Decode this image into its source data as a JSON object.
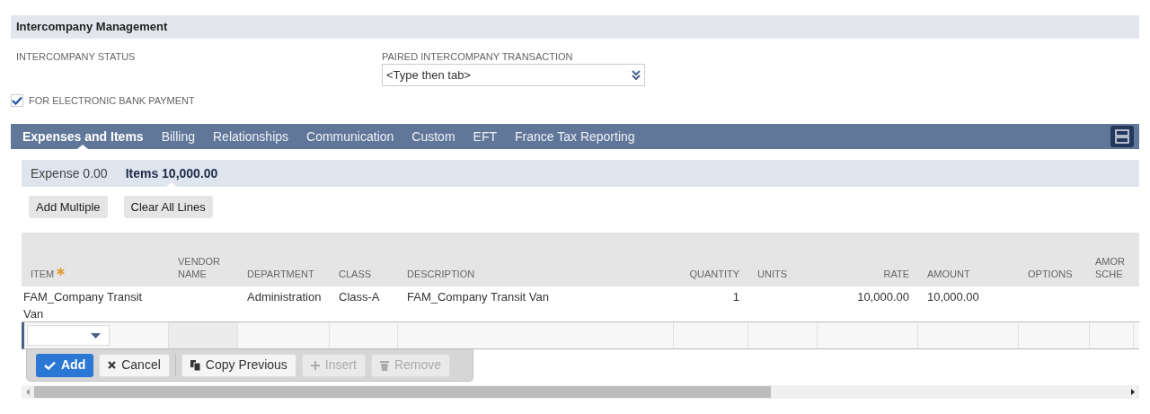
{
  "section": {
    "title": "Intercompany Management"
  },
  "fields": [
    {
      "kind": "text",
      "label": "INTERCOMPANY STATUS"
    },
    {
      "kind": "select",
      "label": "PAIRED INTERCOMPANY TRANSACTION",
      "placeholder": "<Type then tab>"
    }
  ],
  "checkbox": {
    "label": "FOR ELECTRONIC BANK PAYMENT",
    "checked": true
  },
  "tabs": [
    {
      "label": "Expenses and Items",
      "selected": true
    },
    {
      "label": "Billing",
      "selected": false
    },
    {
      "label": "Relationships",
      "selected": false
    },
    {
      "label": "Communication",
      "selected": false
    },
    {
      "label": "Custom",
      "selected": false
    },
    {
      "label": "EFT",
      "selected": false
    },
    {
      "label": "France Tax Reporting",
      "selected": false
    }
  ],
  "subtabs": [
    {
      "label": "Expense 0.00",
      "selected": false
    },
    {
      "label": "Items 10,000.00",
      "selected": true
    }
  ],
  "buttons": [
    "Add Multiple",
    "Clear All Lines"
  ],
  "table": {
    "columns": [
      {
        "label": "ITEM",
        "required": true
      },
      {
        "label": "VENDOR NAME",
        "required": false
      },
      {
        "label": "DEPARTMENT",
        "required": false
      },
      {
        "label": "CLASS",
        "required": false
      },
      {
        "label": "DESCRIPTION",
        "required": false
      },
      {
        "label": "QUANTITY",
        "required": false
      },
      {
        "label": "UNITS",
        "required": false
      },
      {
        "label": "RATE",
        "required": false
      },
      {
        "label": "AMOUNT",
        "required": false
      },
      {
        "label": "OPTIONS",
        "required": false
      },
      {
        "label": "AMOR SCHE",
        "required": false
      }
    ],
    "rows": [
      [
        "FAM_Company Transit Van",
        "",
        "Administration",
        "Class-A",
        "FAM_Company Transit Van",
        "1",
        "",
        "10,000.00",
        "10,000.00",
        "",
        ""
      ]
    ]
  },
  "line_actions": [
    {
      "label": "Add",
      "kind": "primary",
      "disabled": false
    },
    {
      "label": "Cancel",
      "kind": "normal",
      "disabled": false
    },
    {
      "label": "Copy Previous",
      "kind": "normal",
      "disabled": false
    },
    {
      "label": "Insert",
      "kind": "normal",
      "disabled": true
    },
    {
      "label": "Remove",
      "kind": "normal",
      "disabled": true
    }
  ]
}
